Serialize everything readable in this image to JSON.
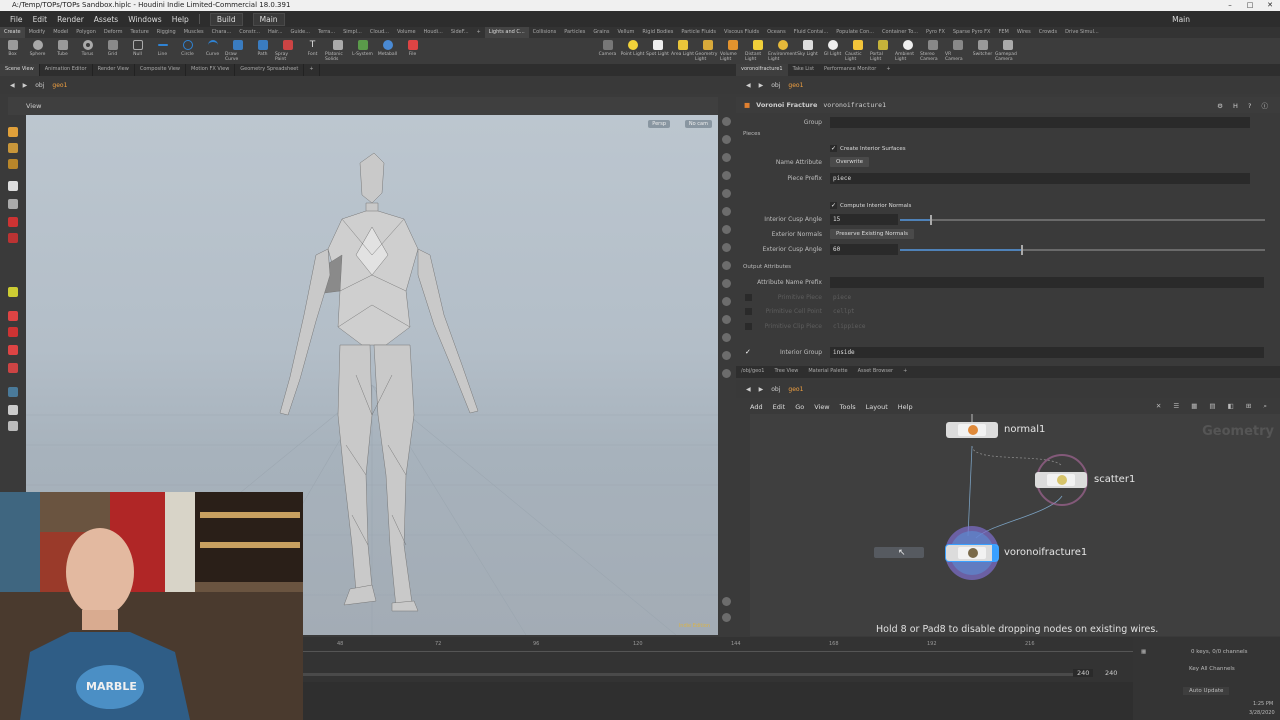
{
  "window": {
    "title": "A:/Temp/TOPs/TOPs Sandbox.hiplc - Houdini Indie Limited-Commercial 18.0.391"
  },
  "menu": {
    "items": [
      "File",
      "Edit",
      "Render",
      "Assets",
      "Windows",
      "Help"
    ],
    "build": "Build",
    "desktop": "Main",
    "desktop_right": "Main"
  },
  "shelf": {
    "tabs_left": [
      "Create",
      "Modify",
      "Model",
      "Polygon",
      "Deform",
      "Texture",
      "Rigging",
      "Muscles",
      "Chara...",
      "Constr...",
      "Hair...",
      "Guide...",
      "Terra...",
      "Simpl...",
      "Cloud...",
      "Volume",
      "Houdi...",
      "SideF..."
    ],
    "tabs_right": [
      "Lights and C...",
      "Collisions",
      "Particles",
      "Grains",
      "Vellum",
      "Rigid Bodies",
      "Particle Fluids",
      "Viscous Fluids",
      "Oceans",
      "Fluid Contai...",
      "Populate Con...",
      "Container To...",
      "Pyro FX",
      "Sparse Pyro FX",
      "FEM",
      "Wires",
      "Crowds",
      "Drive Simul..."
    ],
    "tools_left": [
      "Box",
      "Sphere",
      "Tube",
      "Torus",
      "Grid",
      "Null",
      "Line",
      "Circle",
      "Curve",
      "Draw Curve",
      "Path",
      "Spray Paint",
      "Font",
      "Platonic Solids",
      "L-System",
      "Metaball",
      "File"
    ],
    "tools_right": [
      "Camera",
      "Point Light",
      "Spot Light",
      "Area Light",
      "Geometry Light",
      "Volume Light",
      "Distant Light",
      "Environment Light",
      "Sky Light",
      "GI Light",
      "Caustic Light",
      "Portal Light",
      "Ambient Light",
      "Stereo Camera",
      "VR Camera",
      "Switcher",
      "Gamepad Camera"
    ]
  },
  "left_pane": {
    "tabs": [
      "Scene View",
      "Animation Editor",
      "Render View",
      "Composite View",
      "Motion FX View",
      "Geometry Spreadsheet"
    ],
    "path": [
      "obj",
      "geo1"
    ],
    "header": "View",
    "persp": "Persp",
    "cam": "No cam",
    "watermark": "Indie Edition"
  },
  "right_pane": {
    "tabs": [
      "voronoifracture1",
      "Take List",
      "Performance Monitor"
    ],
    "path": [
      "obj",
      "geo1"
    ],
    "node_type": "Voronoi Fracture",
    "node_name": "voronoifracture1",
    "params": {
      "group_label": "Group",
      "pieces_section": "Pieces",
      "create_interior": "Create Interior Surfaces",
      "name_attr_label": "Name Attribute",
      "name_attr_value": "Overwrite",
      "piece_prefix_label": "Piece Prefix",
      "piece_prefix_value": "piece",
      "compute_normals": "Compute Interior Normals",
      "cusp_label": "Interior Cusp Angle",
      "cusp_value": "15",
      "ext_normals_label": "Exterior Normals",
      "ext_normals_value": "Preserve Existing Normals",
      "ext_cusp_label": "Exterior Cusp Angle",
      "ext_cusp_value": "60",
      "output_section": "Output Attributes",
      "attr_prefix_label": "Attribute Name Prefix",
      "prim_piece_label": "Primitive Piece",
      "prim_piece_value": "piece",
      "prim_cell_label": "Primitive Cell Point",
      "prim_cell_value": "cellpt",
      "prim_clip_label": "Primitive Clip Piece",
      "prim_clip_value": "clippiece",
      "interior_group_label": "Interior Group",
      "interior_group_value": "inside"
    }
  },
  "network_pane": {
    "tabs": [
      "/obj/geo1",
      "Tree View",
      "Material Palette",
      "Asset Browser"
    ],
    "path": [
      "obj",
      "geo1"
    ],
    "menu": [
      "Add",
      "Edit",
      "Go",
      "View",
      "Tools",
      "Layout",
      "Help"
    ],
    "context_label": "Geometry",
    "nodes": {
      "normal": "normal1",
      "scatter": "scatter1",
      "voronoi": "voronoifracture1"
    },
    "hint": "Hold 8 or Pad8 to disable dropping nodes on existing wires."
  },
  "timeline": {
    "ticks": [
      "48",
      "72",
      "96",
      "120",
      "144",
      "168",
      "192",
      "216"
    ],
    "end_frame": "240",
    "end_frame2": "240"
  },
  "playbar_right": {
    "keys": "0 keys, 0/0 channels",
    "key_all": "Key All Channels",
    "auto_update": "Auto Update"
  },
  "taskbar": {
    "time": "1:25 PM",
    "date": "3/28/2020"
  }
}
